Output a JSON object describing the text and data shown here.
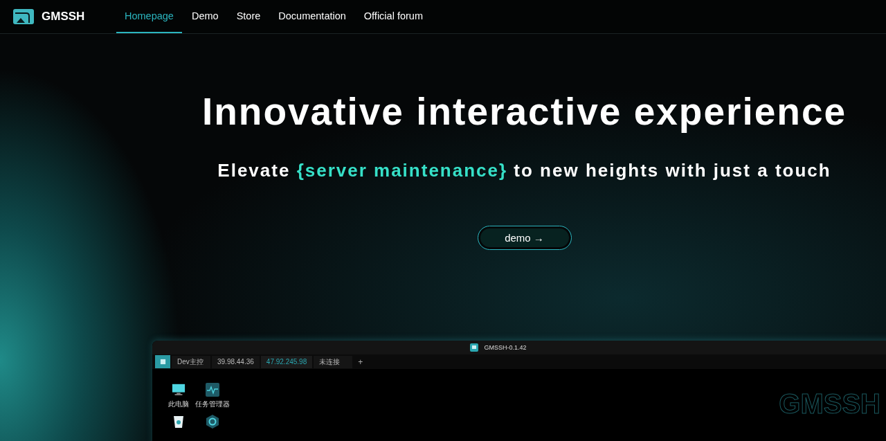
{
  "nav": {
    "brand": "GMSSH",
    "items": [
      {
        "label": "Homepage",
        "selected": true
      },
      {
        "label": "Demo",
        "selected": false
      },
      {
        "label": "Store",
        "selected": false
      },
      {
        "label": "Documentation",
        "selected": false
      },
      {
        "label": "Official forum",
        "selected": false
      }
    ]
  },
  "hero": {
    "title": "Innovative interactive experience",
    "subtitle": "Elevate **{server maintenance}** to new heights with just a touch",
    "button": "demo →"
  },
  "app_window": {
    "title": "GMSSH-0.1.42",
    "tabs": [
      {
        "label": "Dev主控",
        "selected": false
      },
      {
        "label": "39.98.44.36",
        "selected": false
      },
      {
        "label": "47.92.245.98",
        "selected": true
      },
      {
        "label": "未连接",
        "selected": false
      }
    ],
    "add": "+",
    "desktop_icons": [
      {
        "kind": "monitor",
        "label": "此电脑"
      },
      {
        "kind": "activity",
        "label": "任务管理器"
      },
      {
        "kind": "trash"
      },
      {
        "kind": "hex"
      }
    ],
    "wordmark": "GMSSH"
  }
}
